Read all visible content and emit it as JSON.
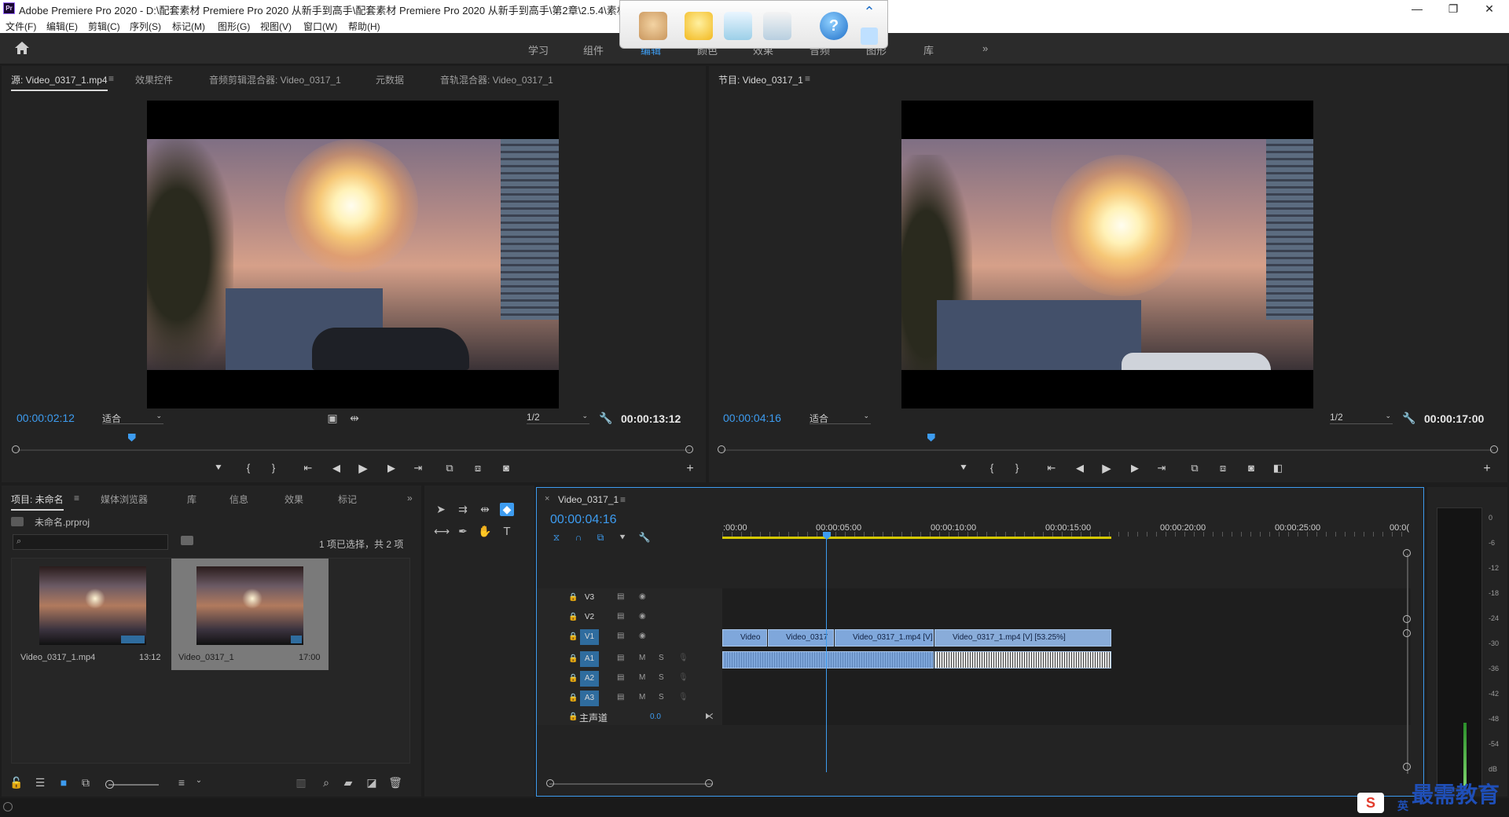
{
  "titlebar": {
    "app_badge": "Pr",
    "title": "Adobe Premiere Pro 2020 - D:\\配套素材 Premiere Pro 2020 从新手到高手\\配套素材 Premiere Pro 2020 从新手到高手\\第2章\\2.5.4\\素材\\未",
    "minimize": "—",
    "restore": "❐",
    "close": "✕"
  },
  "menu": [
    "文件(F)",
    "编辑(E)",
    "剪辑(C)",
    "序列(S)",
    "标记(M)",
    "图形(G)",
    "视图(V)",
    "窗口(W)",
    "帮助(H)"
  ],
  "workspace": {
    "tabs": [
      "学习",
      "组件",
      "编辑",
      "颜色",
      "效果",
      "音频",
      "图形",
      "库"
    ],
    "more": "»"
  },
  "source_panel": {
    "tabs": [
      "源: Video_0317_1.mp4",
      "效果控件",
      "音频剪辑混合器: Video_0317_1",
      "元数据",
      "音轨混合器: Video_0317_1"
    ],
    "menu_glyph": "≡",
    "timecode": "00:00:02:12",
    "fit": "适合",
    "resolution": "1/2",
    "duration": "00:00:13:12",
    "playhead_fraction": 0.17
  },
  "program_panel": {
    "tab": "节目: Video_0317_1",
    "menu_glyph": "≡",
    "timecode": "00:00:04:16",
    "fit": "适合",
    "resolution": "1/2",
    "duration": "00:00:17:00",
    "playhead_fraction": 0.27
  },
  "project_panel": {
    "tabs": [
      "项目: 未命名",
      "媒体浏览器",
      "库",
      "信息",
      "效果",
      "标记"
    ],
    "menu_glyph": "≡",
    "more": "»",
    "file": "未命名.prproj",
    "search_placeholder": "",
    "selection_info": "1 项已选择，共 2 项",
    "items": [
      {
        "name": "Video_0317_1.mp4",
        "duration": "13:12"
      },
      {
        "name": "Video_0317_1",
        "duration": "17:00"
      }
    ]
  },
  "timeline": {
    "tab": "Video_0317_1",
    "close_glyph": "×",
    "menu_glyph": "≡",
    "timecode": "00:00:04:16",
    "ruler": [
      ":00:00",
      "00:00:05:00",
      "00:00:10:00",
      "00:00:15:00",
      "00:00:20:00",
      "00:00:25:00",
      "00:0("
    ],
    "tracks": [
      {
        "name": "V3",
        "type": "video"
      },
      {
        "name": "V2",
        "type": "video"
      },
      {
        "name": "V1",
        "type": "video",
        "targeted": true
      },
      {
        "name": "A1",
        "type": "audio",
        "targeted": true
      },
      {
        "name": "A2",
        "type": "audio"
      },
      {
        "name": "A3",
        "type": "audio"
      }
    ],
    "audio_track_labels": {
      "mute": "M",
      "solo": "S"
    },
    "master": {
      "label": "主声道",
      "value": "0.0"
    },
    "clips": [
      "Video",
      "Video_0317",
      "Video_0317_1.mp4 [V]",
      "Video_0317_1.mp4 [V] [53.25%]"
    ]
  },
  "meter": {
    "labels": [
      "0",
      "-6",
      "-12",
      "-18",
      "-24",
      "-30",
      "-36",
      "-42",
      "-48",
      "-54",
      "dB"
    ]
  },
  "watermark": "最需教育",
  "ime": {
    "logo": "S",
    "lang": "英"
  },
  "colors": {
    "accent": "#3d9cf0",
    "clip": "#7fa7db",
    "track_target": "#2f6c9e"
  }
}
